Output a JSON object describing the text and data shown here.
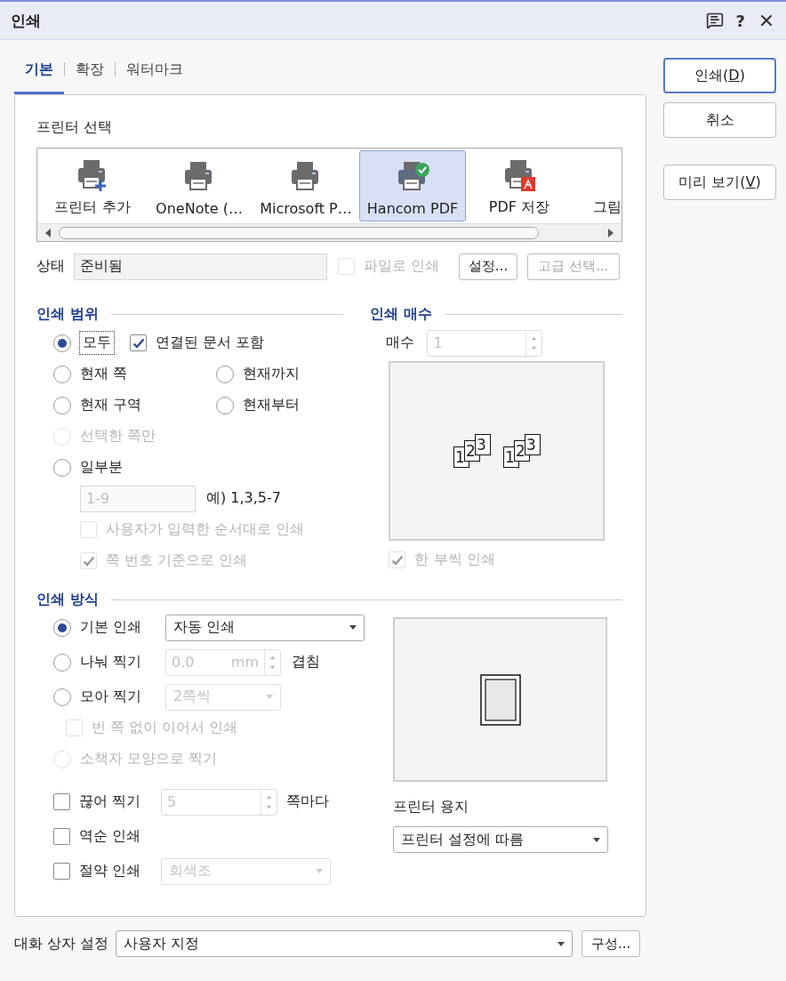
{
  "window": {
    "title": "인쇄",
    "help": "?"
  },
  "tabs": [
    {
      "label": "기본",
      "selected": true
    },
    {
      "label": "확장",
      "selected": false
    },
    {
      "label": "워터마크",
      "selected": false
    }
  ],
  "buttons": [
    {
      "parts": [
        "인쇄(",
        "D",
        ")"
      ],
      "default": true
    },
    {
      "parts": [
        "취소"
      ],
      "default": false
    },
    {
      "parts": [
        "미리 보기(",
        "V",
        ")"
      ],
      "default": false
    }
  ],
  "printer_select": {
    "label": "프린터 선택",
    "printers": [
      {
        "name": "프린터 추가",
        "kind": "add",
        "selected": false
      },
      {
        "name": "OneNote (…",
        "kind": "plain",
        "selected": false
      },
      {
        "name": "Microsoft P…",
        "kind": "plain",
        "selected": false
      },
      {
        "name": "Hancom PDF",
        "kind": "check",
        "selected": true
      },
      {
        "name": "PDF 저장",
        "kind": "pdf",
        "selected": false
      },
      {
        "name": "그림",
        "kind": "hidden",
        "selected": false
      }
    ],
    "status_label": "상태",
    "status_value": "준비됨",
    "print_to_file": {
      "label": "파일로 인쇄",
      "checked": false,
      "disabled": true
    },
    "settings_button": {
      "label": "설정...",
      "disabled": false
    },
    "advanced_button": {
      "label": "고급 선택...",
      "disabled": true
    }
  },
  "print_range": {
    "title": "인쇄 범위",
    "options": [
      {
        "label": "모두",
        "selected": true,
        "disabled": false
      },
      {
        "label": "현재 쪽",
        "selected": false,
        "disabled": false
      },
      {
        "label": "현재까지",
        "selected": false,
        "disabled": false
      },
      {
        "label": "현재 구역",
        "selected": false,
        "disabled": false
      },
      {
        "label": "현재부터",
        "selected": false,
        "disabled": false
      },
      {
        "label": "선택한 쪽만",
        "selected": false,
        "disabled": true
      },
      {
        "label": "일부분",
        "selected": false,
        "disabled": false
      }
    ],
    "include_linked": {
      "label": "연결된 문서 포함",
      "checked": true,
      "disabled": false
    },
    "pages_value": "1-9",
    "example": "예) 1,3,5-7",
    "order_option": {
      "label": "사용자가 입력한 순서대로 인쇄",
      "checked": false,
      "disabled": true
    },
    "page_number_option": {
      "label": "쪽 번호 기준으로 인쇄",
      "checked": true,
      "disabled": true
    }
  },
  "copies": {
    "title": "인쇄 매수",
    "label": "매수",
    "value": "1",
    "stacks": [
      [
        "1",
        "2",
        "3"
      ],
      [
        "1",
        "2",
        "3"
      ]
    ],
    "collate": {
      "label": "한 부씩 인쇄",
      "checked": true,
      "disabled": true
    }
  },
  "print_method": {
    "title": "인쇄 방식",
    "options": [
      {
        "label": "기본 인쇄",
        "selected": true,
        "disabled": false
      },
      {
        "label": "나눠 찍기",
        "selected": false,
        "disabled": false
      },
      {
        "label": "모아 찍기",
        "selected": false,
        "disabled": false
      },
      {
        "label": "소책자 모양으로 찍기",
        "selected": false,
        "disabled": true
      }
    ],
    "basic_mode": "자동 인쇄",
    "split_value": "0.0",
    "split_unit": "mm",
    "split_suffix": "겹침",
    "combine_value": "2쪽씩",
    "no_blank": {
      "label": "빈 쪽 없이 이어서 인쇄",
      "checked": false,
      "disabled": true
    },
    "checks": [
      {
        "label": "끊어 찍기",
        "checked": false,
        "disabled": false
      },
      {
        "label": "역순 인쇄",
        "checked": false,
        "disabled": false
      },
      {
        "label": "절약 인쇄",
        "checked": false,
        "disabled": false
      }
    ],
    "break_value": "5",
    "break_suffix": "쪽마다",
    "save_mode": "회색조",
    "paper_label": "프린터 용지",
    "paper_value": "프린터 설정에 따름"
  },
  "dialog_settings": {
    "label": "대화 상자 설정",
    "value": "사용자 지정",
    "button": "구성..."
  }
}
